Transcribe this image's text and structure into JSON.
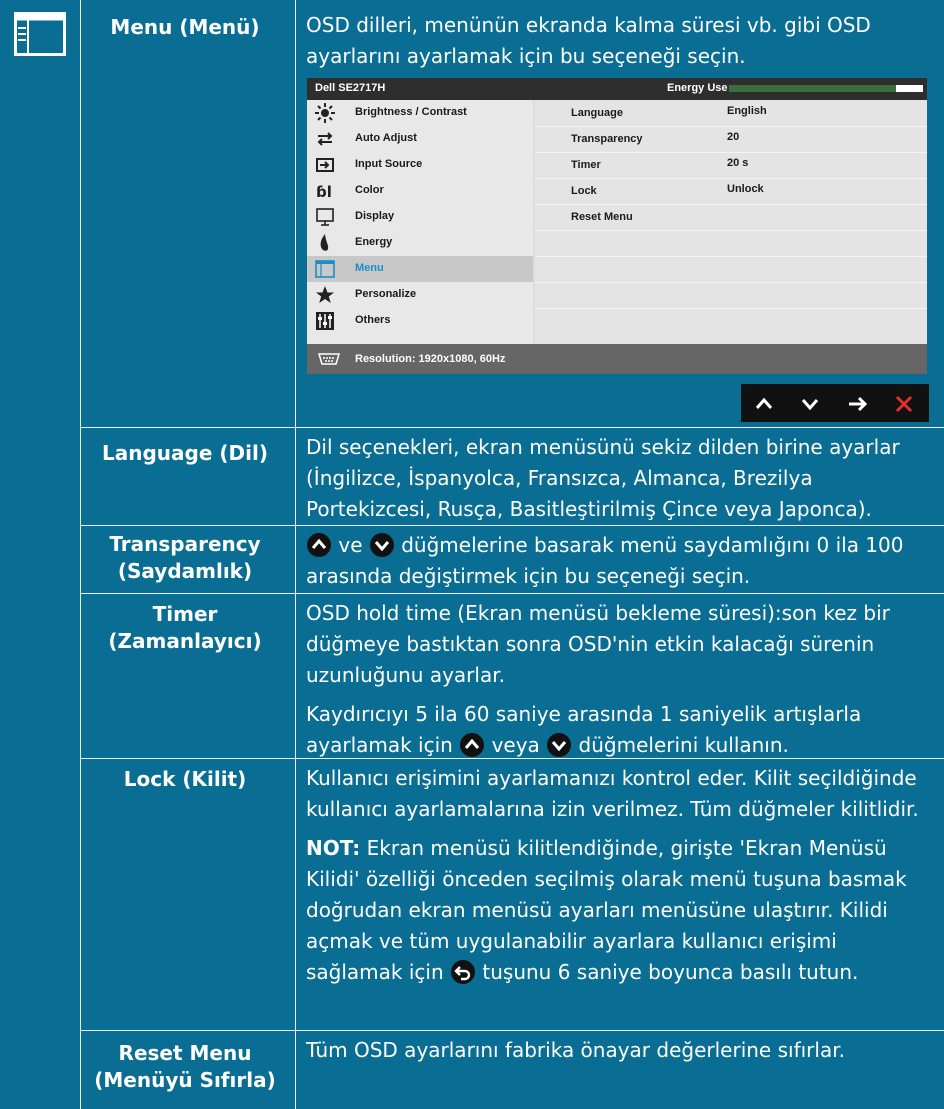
{
  "rows": [
    {
      "label": "Menu (Menü)",
      "text": "OSD dilleri, menünün ekranda kalma süresi vb. gibi OSD ayarlarını ayarlamak için bu seçeneği seçin."
    },
    {
      "label": "Language (Dil)",
      "text": "Dil seçenekleri, ekran menüsünü sekiz dilden birine ayarlar (İngilizce, İspanyolca, Fransızca, Almanca, Brezilya Portekizcesi, Rusça, Basitleştirilmiş Çince veya Japonca)."
    },
    {
      "label_line1": "Transparency",
      "label_line2": "(Saydamlık)",
      "text_a": "ve",
      "text_b": "düğmelerine basarak menü saydamlığını 0 ila 100 arasında değiştirmek için bu seçeneği seçin."
    },
    {
      "label_line1": "Timer",
      "label_line2": "(Zamanlayıcı)",
      "text": "OSD hold time (Ekran menüsü bekleme süresi):son kez bir düğmeye bastıktan sonra OSD'nin etkin kalacağı sürenin uzunluğunu ayarlar.",
      "text2_a": "Kaydırıcıyı 5 ila 60 saniye arasında 1 saniyelik artışlarla ayarlamak için",
      "text2_b": "veya",
      "text2_c": "düğmelerini kullanın."
    },
    {
      "label": "Lock (Kilit)",
      "text": "Kullanıcı erişimini ayarlamanızı kontrol eder. Kilit seçildiğinde kullanıcı ayarlamalarına izin verilmez. Tüm düğmeler kilitlidir.",
      "note_label": "NOT:",
      "note_a": "Ekran menüsü kilitlendiğinde, girişte 'Ekran Menüsü Kilidi' özelliği önceden seçilmiş olarak menü tuşuna basmak doğrudan ekran menüsü ayarları menüsüne ulaştırır. Kilidi açmak ve tüm uygulanabilir ayarlara kullanıcı erişimi sağlamak için",
      "note_b": "tuşunu 6 saniye boyunca basılı tutun."
    },
    {
      "label_line1": "Reset Menu",
      "label_line2": "(Menüyü Sıfırla)",
      "text": "Tüm OSD ayarlarını fabrika önayar değerlerine sıfırlar."
    }
  ],
  "osd": {
    "model": "Dell SE2717H",
    "energy_label": "Energy Use",
    "energy_level": 0.86,
    "menu": [
      {
        "label": "Brightness / Contrast",
        "icon": "sun-icon"
      },
      {
        "label": "Auto Adjust",
        "icon": "auto-adjust-icon"
      },
      {
        "label": "Input Source",
        "icon": "input-source-icon"
      },
      {
        "label": "Color",
        "icon": "color-icon"
      },
      {
        "label": "Display",
        "icon": "display-icon"
      },
      {
        "label": "Energy",
        "icon": "energy-icon"
      },
      {
        "label": "Menu",
        "icon": "menu-icon",
        "active": true
      },
      {
        "label": "Personalize",
        "icon": "star-icon"
      },
      {
        "label": "Others",
        "icon": "others-icon"
      }
    ],
    "settings": [
      {
        "key": "Language",
        "value": "English"
      },
      {
        "key": "Transparency",
        "value": "20"
      },
      {
        "key": "Timer",
        "value": "20 s"
      },
      {
        "key": "Lock",
        "value": "Unlock"
      },
      {
        "key": "Reset Menu",
        "value": ""
      }
    ],
    "resolution": "Resolution: 1920x1080, 60Hz"
  },
  "colors": {
    "background": "#0a6e94",
    "lines": "#e8f1f5",
    "osd_active": "#1a8ec8",
    "close": "#e0302a"
  }
}
